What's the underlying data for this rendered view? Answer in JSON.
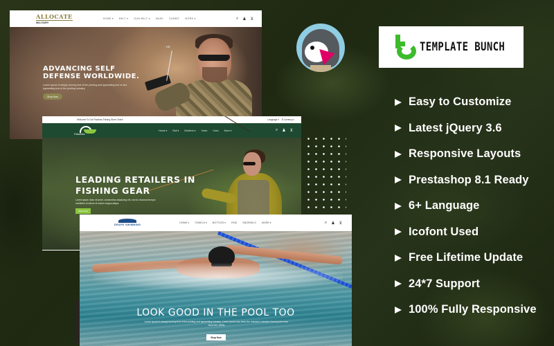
{
  "military_site": {
    "logo_top": "ALLOCATE",
    "logo_bottom": "MILITARY",
    "nav": [
      "HOME ▾",
      "BELT ▾",
      "GUN BELT ▾",
      "MASK",
      "SONBIT",
      "MORE ▾"
    ],
    "hero_title_line1": "ADVANCING SELF",
    "hero_title_line2": "DEFENSE WORLDWIDE.",
    "hero_desc": "Lorem Ipsum is simply dummy text of the printing and typesetting text of and typesetting text of the printing industry.",
    "hero_button": "Shop Now",
    "annotation": "HS"
  },
  "fishing_site": {
    "welcome": "Welcome To Our Flawless Fishing Store Online",
    "language": "Language ▾",
    "currency": "$ Currency ▾",
    "logo_text": "Flawless",
    "nav": [
      "Home ▾",
      "Bait ▾",
      "Bobbers ▾",
      "Voice",
      "Uses",
      "More ▾"
    ],
    "hero_title_line1": "LEADING RETAILERS IN",
    "hero_title_line2": "FISHING GEAR",
    "hero_desc": "Lorem ipsum dolor sit amet, consectetur adipiscing elit, sed do eiusmod tempor incididunt ut labore et dolore magna aliqua.",
    "hero_button": "Shop Now"
  },
  "swimming_site": {
    "logo_text": "DRAPE SWIMMING",
    "nav": [
      "HOME ▾",
      "TOWELS ▾",
      "BOTTLES ▾",
      "FINS",
      "SNORKELS",
      "MORE ▾"
    ],
    "hero_title": "LOOK GOOD IN THE POOL TOO",
    "hero_desc": "Lorem Ipsum is simply dummy text of the printing and typesetting industry. Lorem Ipsum has been the industry's standard dummy text ever since the 1500s",
    "hero_button": "Shop Now"
  },
  "brand": {
    "name": "TEMPLATE BUNCH",
    "accent": "#3dbb2c",
    "platform_logo": "prestashop-puffin-icon"
  },
  "features": [
    "Easy to Customize",
    "Latest jQuery 3.6",
    "Responsive Layouts",
    "Prestashop 8.1 Ready",
    "6+ Language",
    "Icofont Used",
    "Free Lifetime Update",
    "24*7 Support",
    "100% Fully Responsive"
  ],
  "icons": {
    "search": "⌕",
    "user": "♟",
    "cart": "🛒"
  }
}
